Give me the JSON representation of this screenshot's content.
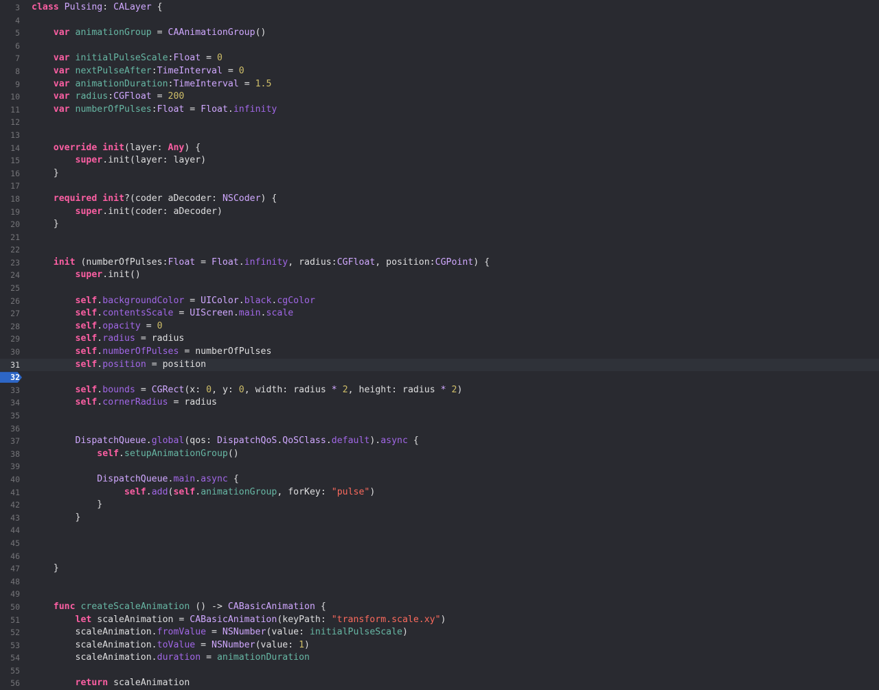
{
  "editor": {
    "current_line": "31",
    "breakpoint_line": "32",
    "colors": {
      "background": "#292a30",
      "current_line_highlight": "#2f3239",
      "breakpoint": "#2d66c6",
      "line_number": "#747478",
      "plain": "#dfdfe0",
      "keyword": "#fc5fa3",
      "declaration": "#67b7a4",
      "type": "#d0a8ff",
      "member": "#a167e6",
      "number": "#d0bf69",
      "string": "#fc6a5d"
    },
    "lines": [
      {
        "no": "3",
        "tokens": [
          [
            "kw",
            "class"
          ],
          [
            "pl",
            " "
          ],
          [
            "ty",
            "Pulsing"
          ],
          [
            "pl",
            ": "
          ],
          [
            "ty",
            "CALayer"
          ],
          [
            "pl",
            " {"
          ]
        ]
      },
      {
        "no": "4",
        "tokens": []
      },
      {
        "no": "5",
        "tokens": [
          [
            "pl",
            "    "
          ],
          [
            "kw",
            "var"
          ],
          [
            "pl",
            " "
          ],
          [
            "id",
            "animationGroup"
          ],
          [
            "pl",
            " = "
          ],
          [
            "ty",
            "CAAnimationGroup"
          ],
          [
            "pl",
            "()"
          ]
        ]
      },
      {
        "no": "6",
        "tokens": []
      },
      {
        "no": "7",
        "tokens": [
          [
            "pl",
            "    "
          ],
          [
            "kw",
            "var"
          ],
          [
            "pl",
            " "
          ],
          [
            "id",
            "initialPulseScale"
          ],
          [
            "pl",
            ":"
          ],
          [
            "ty",
            "Float"
          ],
          [
            "pl",
            " = "
          ],
          [
            "nu",
            "0"
          ]
        ]
      },
      {
        "no": "8",
        "tokens": [
          [
            "pl",
            "    "
          ],
          [
            "kw",
            "var"
          ],
          [
            "pl",
            " "
          ],
          [
            "id",
            "nextPulseAfter"
          ],
          [
            "pl",
            ":"
          ],
          [
            "ty",
            "TimeInterval"
          ],
          [
            "pl",
            " = "
          ],
          [
            "nu",
            "0"
          ]
        ]
      },
      {
        "no": "9",
        "tokens": [
          [
            "pl",
            "    "
          ],
          [
            "kw",
            "var"
          ],
          [
            "pl",
            " "
          ],
          [
            "id",
            "animationDuration"
          ],
          [
            "pl",
            ":"
          ],
          [
            "ty",
            "TimeInterval"
          ],
          [
            "pl",
            " = "
          ],
          [
            "nu",
            "1.5"
          ]
        ]
      },
      {
        "no": "10",
        "tokens": [
          [
            "pl",
            "    "
          ],
          [
            "kw",
            "var"
          ],
          [
            "pl",
            " "
          ],
          [
            "id",
            "radius"
          ],
          [
            "pl",
            ":"
          ],
          [
            "ty",
            "CGFloat"
          ],
          [
            "pl",
            " = "
          ],
          [
            "nu",
            "200"
          ]
        ]
      },
      {
        "no": "11",
        "tokens": [
          [
            "pl",
            "    "
          ],
          [
            "kw",
            "var"
          ],
          [
            "pl",
            " "
          ],
          [
            "id",
            "numberOfPulses"
          ],
          [
            "pl",
            ":"
          ],
          [
            "ty",
            "Float"
          ],
          [
            "pl",
            " = "
          ],
          [
            "ty",
            "Float"
          ],
          [
            "pl",
            "."
          ],
          [
            "fn",
            "infinity"
          ]
        ]
      },
      {
        "no": "12",
        "tokens": []
      },
      {
        "no": "13",
        "tokens": []
      },
      {
        "no": "14",
        "tokens": [
          [
            "pl",
            "    "
          ],
          [
            "kw",
            "override"
          ],
          [
            "pl",
            " "
          ],
          [
            "kw",
            "init"
          ],
          [
            "pl",
            "(layer: "
          ],
          [
            "kw",
            "Any"
          ],
          [
            "pl",
            ") {"
          ]
        ]
      },
      {
        "no": "15",
        "tokens": [
          [
            "pl",
            "        "
          ],
          [
            "kw",
            "super"
          ],
          [
            "pl",
            "."
          ],
          [
            "pl",
            "init(layer: layer)"
          ]
        ]
      },
      {
        "no": "16",
        "tokens": [
          [
            "pl",
            "    }"
          ]
        ]
      },
      {
        "no": "17",
        "tokens": []
      },
      {
        "no": "18",
        "tokens": [
          [
            "pl",
            "    "
          ],
          [
            "kw",
            "required"
          ],
          [
            "pl",
            " "
          ],
          [
            "kw",
            "init"
          ],
          [
            "pl",
            "?(coder aDecoder: "
          ],
          [
            "ty",
            "NSCoder"
          ],
          [
            "pl",
            ") {"
          ]
        ]
      },
      {
        "no": "19",
        "tokens": [
          [
            "pl",
            "        "
          ],
          [
            "kw",
            "super"
          ],
          [
            "pl",
            "."
          ],
          [
            "pl",
            "init(coder: aDecoder)"
          ]
        ]
      },
      {
        "no": "20",
        "tokens": [
          [
            "pl",
            "    }"
          ]
        ]
      },
      {
        "no": "21",
        "tokens": []
      },
      {
        "no": "22",
        "tokens": []
      },
      {
        "no": "23",
        "tokens": [
          [
            "pl",
            "    "
          ],
          [
            "kw",
            "init"
          ],
          [
            "pl",
            " (numberOfPulses:"
          ],
          [
            "ty",
            "Float"
          ],
          [
            "pl",
            " = "
          ],
          [
            "ty",
            "Float"
          ],
          [
            "pl",
            "."
          ],
          [
            "fn",
            "infinity"
          ],
          [
            "pl",
            ", radius:"
          ],
          [
            "ty",
            "CGFloat"
          ],
          [
            "pl",
            ", position:"
          ],
          [
            "ty",
            "CGPoint"
          ],
          [
            "pl",
            ") {"
          ]
        ]
      },
      {
        "no": "24",
        "tokens": [
          [
            "pl",
            "        "
          ],
          [
            "kw",
            "super"
          ],
          [
            "pl",
            "."
          ],
          [
            "pl",
            "init()"
          ]
        ]
      },
      {
        "no": "25",
        "tokens": []
      },
      {
        "no": "26",
        "tokens": [
          [
            "pl",
            "        "
          ],
          [
            "kw",
            "self"
          ],
          [
            "pl",
            "."
          ],
          [
            "fn",
            "backgroundColor"
          ],
          [
            "pl",
            " = "
          ],
          [
            "ty",
            "UIColor"
          ],
          [
            "pl",
            "."
          ],
          [
            "fn",
            "black"
          ],
          [
            "pl",
            "."
          ],
          [
            "fn",
            "cgColor"
          ]
        ]
      },
      {
        "no": "27",
        "tokens": [
          [
            "pl",
            "        "
          ],
          [
            "kw",
            "self"
          ],
          [
            "pl",
            "."
          ],
          [
            "fn",
            "contentsScale"
          ],
          [
            "pl",
            " = "
          ],
          [
            "ty",
            "UIScreen"
          ],
          [
            "pl",
            "."
          ],
          [
            "fn",
            "main"
          ],
          [
            "pl",
            "."
          ],
          [
            "fn",
            "scale"
          ]
        ]
      },
      {
        "no": "28",
        "tokens": [
          [
            "pl",
            "        "
          ],
          [
            "kw",
            "self"
          ],
          [
            "pl",
            "."
          ],
          [
            "fn",
            "opacity"
          ],
          [
            "pl",
            " = "
          ],
          [
            "nu",
            "0"
          ]
        ]
      },
      {
        "no": "29",
        "tokens": [
          [
            "pl",
            "        "
          ],
          [
            "kw",
            "self"
          ],
          [
            "pl",
            "."
          ],
          [
            "fn",
            "radius"
          ],
          [
            "pl",
            " = radius"
          ]
        ]
      },
      {
        "no": "30",
        "tokens": [
          [
            "pl",
            "        "
          ],
          [
            "kw",
            "self"
          ],
          [
            "pl",
            "."
          ],
          [
            "fn",
            "numberOfPulses"
          ],
          [
            "pl",
            " = numberOfPulses"
          ]
        ]
      },
      {
        "no": "31",
        "tokens": [
          [
            "pl",
            "        "
          ],
          [
            "kw",
            "self"
          ],
          [
            "pl",
            "."
          ],
          [
            "fn",
            "position"
          ],
          [
            "pl",
            " = position"
          ]
        ]
      },
      {
        "no": "32",
        "tokens": []
      },
      {
        "no": "33",
        "tokens": [
          [
            "pl",
            "        "
          ],
          [
            "kw",
            "self"
          ],
          [
            "pl",
            "."
          ],
          [
            "fn",
            "bounds"
          ],
          [
            "pl",
            " = "
          ],
          [
            "ty",
            "CGRect"
          ],
          [
            "pl",
            "(x: "
          ],
          [
            "nu",
            "0"
          ],
          [
            "pl",
            ", y: "
          ],
          [
            "nu",
            "0"
          ],
          [
            "pl",
            ", width: radius "
          ],
          [
            "ty",
            "*"
          ],
          [
            "pl",
            " "
          ],
          [
            "nu",
            "2"
          ],
          [
            "pl",
            ", height: radius "
          ],
          [
            "ty",
            "*"
          ],
          [
            "pl",
            " "
          ],
          [
            "nu",
            "2"
          ],
          [
            "pl",
            ")"
          ]
        ]
      },
      {
        "no": "34",
        "tokens": [
          [
            "pl",
            "        "
          ],
          [
            "kw",
            "self"
          ],
          [
            "pl",
            "."
          ],
          [
            "fn",
            "cornerRadius"
          ],
          [
            "pl",
            " = radius"
          ]
        ]
      },
      {
        "no": "35",
        "tokens": []
      },
      {
        "no": "36",
        "tokens": []
      },
      {
        "no": "37",
        "tokens": [
          [
            "pl",
            "        "
          ],
          [
            "ty",
            "DispatchQueue"
          ],
          [
            "pl",
            "."
          ],
          [
            "fn",
            "global"
          ],
          [
            "pl",
            "(qos: "
          ],
          [
            "ty",
            "DispatchQoS"
          ],
          [
            "pl",
            "."
          ],
          [
            "ty",
            "QoSClass"
          ],
          [
            "pl",
            "."
          ],
          [
            "fn",
            "default"
          ],
          [
            "pl",
            ")."
          ],
          [
            "fn",
            "async"
          ],
          [
            "pl",
            " {"
          ]
        ]
      },
      {
        "no": "38",
        "tokens": [
          [
            "pl",
            "            "
          ],
          [
            "kw",
            "self"
          ],
          [
            "pl",
            "."
          ],
          [
            "id",
            "setupAnimationGroup"
          ],
          [
            "pl",
            "()"
          ]
        ]
      },
      {
        "no": "39",
        "tokens": []
      },
      {
        "no": "40",
        "tokens": [
          [
            "pl",
            "            "
          ],
          [
            "ty",
            "DispatchQueue"
          ],
          [
            "pl",
            "."
          ],
          [
            "fn",
            "main"
          ],
          [
            "pl",
            "."
          ],
          [
            "fn",
            "async"
          ],
          [
            "pl",
            " {"
          ]
        ]
      },
      {
        "no": "41",
        "tokens": [
          [
            "pl",
            "                 "
          ],
          [
            "kw",
            "self"
          ],
          [
            "pl",
            "."
          ],
          [
            "fn",
            "add"
          ],
          [
            "pl",
            "("
          ],
          [
            "kw",
            "self"
          ],
          [
            "pl",
            "."
          ],
          [
            "id",
            "animationGroup"
          ],
          [
            "pl",
            ", forKey: "
          ],
          [
            "st",
            "\"pulse\""
          ],
          [
            "pl",
            ")"
          ]
        ]
      },
      {
        "no": "42",
        "tokens": [
          [
            "pl",
            "            }"
          ]
        ]
      },
      {
        "no": "43",
        "tokens": [
          [
            "pl",
            "        }"
          ]
        ]
      },
      {
        "no": "44",
        "tokens": []
      },
      {
        "no": "45",
        "tokens": []
      },
      {
        "no": "46",
        "tokens": []
      },
      {
        "no": "47",
        "tokens": [
          [
            "pl",
            "    }"
          ]
        ]
      },
      {
        "no": "48",
        "tokens": []
      },
      {
        "no": "49",
        "tokens": []
      },
      {
        "no": "50",
        "tokens": [
          [
            "pl",
            "    "
          ],
          [
            "kw",
            "func"
          ],
          [
            "pl",
            " "
          ],
          [
            "id",
            "createScaleAnimation"
          ],
          [
            "pl",
            " () -> "
          ],
          [
            "ty",
            "CABasicAnimation"
          ],
          [
            "pl",
            " {"
          ]
        ]
      },
      {
        "no": "51",
        "tokens": [
          [
            "pl",
            "        "
          ],
          [
            "kw",
            "let"
          ],
          [
            "pl",
            " scaleAnimation = "
          ],
          [
            "ty",
            "CABasicAnimation"
          ],
          [
            "pl",
            "(keyPath: "
          ],
          [
            "st",
            "\"transform.scale.xy\""
          ],
          [
            "pl",
            ")"
          ]
        ]
      },
      {
        "no": "52",
        "tokens": [
          [
            "pl",
            "        scaleAnimation."
          ],
          [
            "fn",
            "fromValue"
          ],
          [
            "pl",
            " = "
          ],
          [
            "ty",
            "NSNumber"
          ],
          [
            "pl",
            "(value: "
          ],
          [
            "id",
            "initialPulseScale"
          ],
          [
            "pl",
            ")"
          ]
        ]
      },
      {
        "no": "53",
        "tokens": [
          [
            "pl",
            "        scaleAnimation."
          ],
          [
            "fn",
            "toValue"
          ],
          [
            "pl",
            " = "
          ],
          [
            "ty",
            "NSNumber"
          ],
          [
            "pl",
            "(value: "
          ],
          [
            "nu",
            "1"
          ],
          [
            "pl",
            ")"
          ]
        ]
      },
      {
        "no": "54",
        "tokens": [
          [
            "pl",
            "        scaleAnimation."
          ],
          [
            "fn",
            "duration"
          ],
          [
            "pl",
            " = "
          ],
          [
            "id",
            "animationDuration"
          ]
        ]
      },
      {
        "no": "55",
        "tokens": []
      },
      {
        "no": "56",
        "tokens": [
          [
            "pl",
            "        "
          ],
          [
            "kw",
            "return"
          ],
          [
            "pl",
            " scaleAnimation"
          ]
        ]
      }
    ]
  }
}
